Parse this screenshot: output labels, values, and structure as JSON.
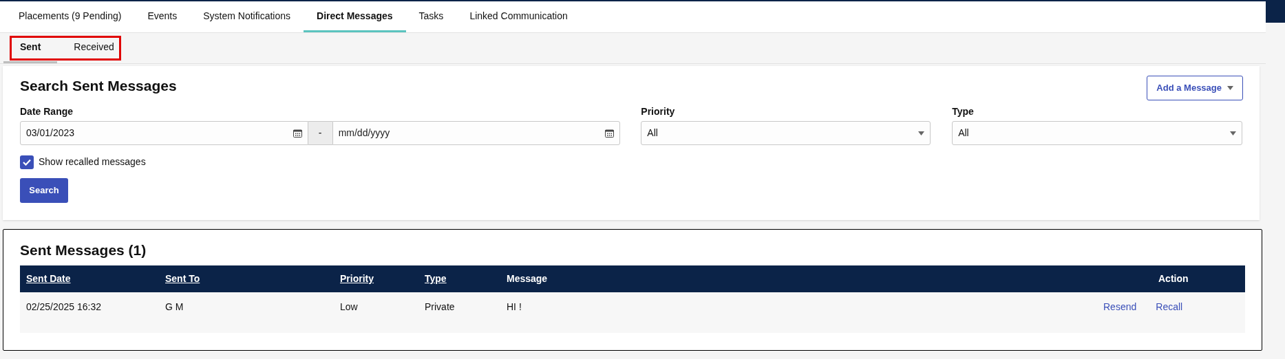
{
  "tabs": [
    {
      "label": "Placements (9 Pending)",
      "selected": false
    },
    {
      "label": "Events",
      "selected": false
    },
    {
      "label": "System Notifications",
      "selected": false
    },
    {
      "label": "Direct Messages",
      "selected": true
    },
    {
      "label": "Tasks",
      "selected": false
    },
    {
      "label": "Linked Communication",
      "selected": false
    }
  ],
  "subtabs": [
    {
      "label": "Sent",
      "selected": true
    },
    {
      "label": "Received",
      "selected": false
    }
  ],
  "search": {
    "title": "Search Sent Messages",
    "add_button": "Add a Message",
    "date_range_label": "Date Range",
    "date_from": "03/01/2023",
    "separator": "-",
    "date_to_placeholder": "mm/dd/yyyy",
    "priority_label": "Priority",
    "priority_value": "All",
    "type_label": "Type",
    "type_value": "All",
    "show_recalled": {
      "label": "Show recalled messages",
      "checked": true
    },
    "search_button": "Search"
  },
  "results": {
    "title": "Sent Messages (1)",
    "columns": [
      {
        "label": "Sent Date",
        "sortable": true
      },
      {
        "label": "Sent To",
        "sortable": true
      },
      {
        "label": "Priority",
        "sortable": true
      },
      {
        "label": "Type",
        "sortable": true
      },
      {
        "label": "Message",
        "sortable": false
      },
      {
        "label": "Action",
        "sortable": false
      }
    ],
    "rows": [
      {
        "cells": [
          "02/25/2025 16:32",
          "G M",
          "Low",
          "Private",
          "HI !"
        ],
        "actions": [
          "Resend",
          "Recall"
        ]
      }
    ]
  }
}
